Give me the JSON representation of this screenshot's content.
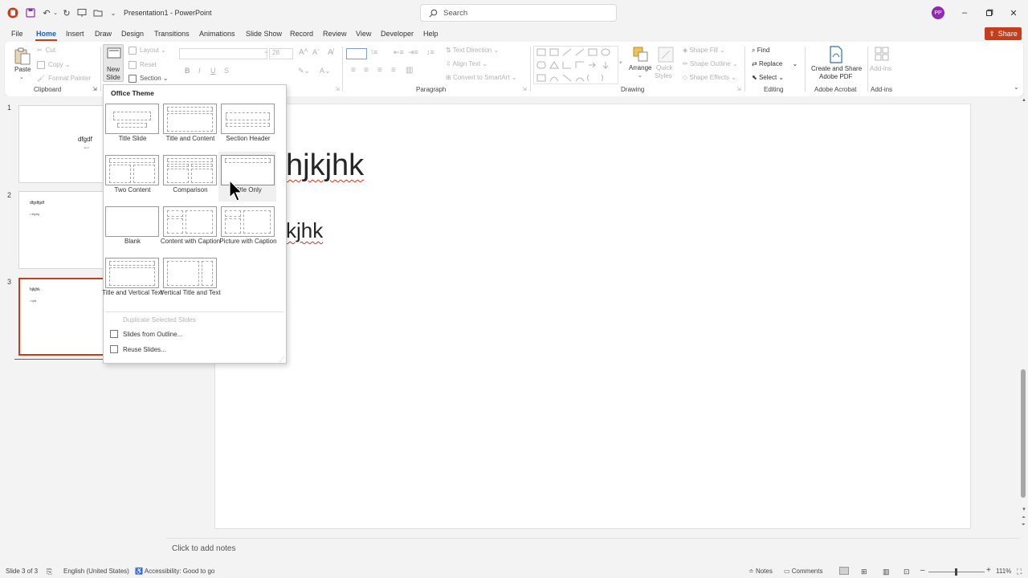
{
  "window": {
    "title": "Presentation1 - PowerPoint",
    "search_placeholder": "Search",
    "user_initials": "PP"
  },
  "menu": {
    "tabs": [
      "File",
      "Home",
      "Insert",
      "Draw",
      "Design",
      "Transitions",
      "Animations",
      "Slide Show",
      "Record",
      "Review",
      "View",
      "Developer",
      "Help"
    ],
    "active_tab": "Home",
    "share": "Share"
  },
  "ribbon": {
    "clipboard": {
      "paste": "Paste",
      "cut": "Cut",
      "copy": "Copy",
      "format_painter": "Format Painter",
      "label": "Clipboard"
    },
    "slides": {
      "new_slide_1": "New",
      "new_slide_2": "Slide",
      "layout": "Layout",
      "reset": "Reset",
      "section": "Section"
    },
    "font": {
      "size": "28"
    },
    "paragraph": {
      "text_direction": "Text Direction",
      "align_text": "Align Text",
      "convert_smartart": "Convert to SmartArt",
      "label": "Paragraph"
    },
    "drawing": {
      "arrange": "Arrange",
      "quick_styles_1": "Quick",
      "quick_styles_2": "Styles",
      "shape_fill": "Shape Fill",
      "shape_outline": "Shape Outline",
      "shape_effects": "Shape Effects",
      "label": "Drawing"
    },
    "editing": {
      "find": "Find",
      "replace": "Replace",
      "select": "Select",
      "label": "Editing"
    },
    "acrobat": {
      "create_1": "Create and Share",
      "create_2": "Adobe PDF",
      "label": "Adobe Acrobat"
    },
    "addins": {
      "addins": "Add-ins",
      "label": "Add-ins"
    }
  },
  "thumbnails": [
    {
      "number": "1",
      "title": "dfgdf",
      "body": "dfgdf"
    },
    {
      "number": "2",
      "title": "dfgdfgdf",
      "body": "• dfgdfg"
    },
    {
      "number": "3",
      "title": "hjkjhk",
      "body": "• kjhk"
    }
  ],
  "slide": {
    "title": "hjkjhk",
    "body": "kjhk"
  },
  "notes_placeholder": "Click to add notes",
  "new_slide_dropdown": {
    "header": "Office Theme",
    "layouts": [
      "Title Slide",
      "Title and Content",
      "Section Header",
      "Two Content",
      "Comparison",
      "Title Only",
      "Blank",
      "Content with Caption",
      "Picture with Caption",
      "Title and Vertical Text",
      "Vertical Title and Text"
    ],
    "hovered_layout": "Title Only",
    "commands": [
      {
        "label": "Duplicate Selected Slides",
        "enabled": false
      },
      {
        "label": "Slides from Outline...",
        "enabled": true
      },
      {
        "label": "Reuse Slides...",
        "enabled": true
      }
    ]
  },
  "status": {
    "slide_count": "Slide 3 of 3",
    "language": "English (United States)",
    "accessibility": "Accessibility: Good to go",
    "notes": "Notes",
    "comments": "Comments",
    "zoom": "111%"
  },
  "colors": {
    "accent": "#c43e1c",
    "active_tab": "#1f5fad",
    "avatar": "#8e2bb0"
  }
}
